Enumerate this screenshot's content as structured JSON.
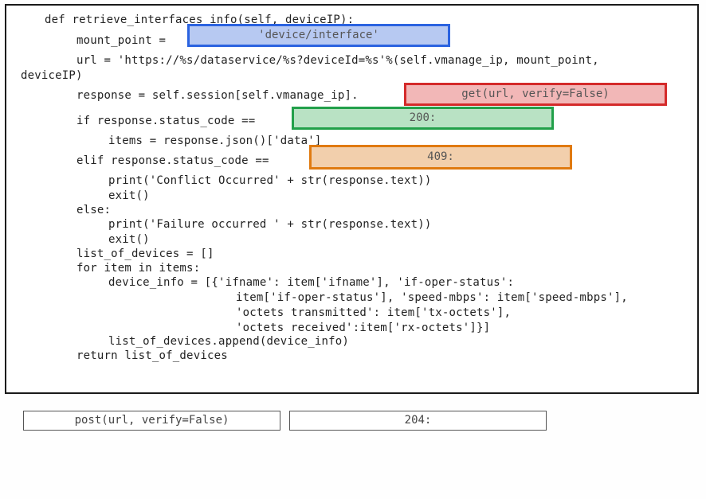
{
  "code": {
    "line1": "def retrieve_interfaces_info(self, deviceIP):",
    "line2": "mount_point = ",
    "line3": "url = 'https://%s/dataservice/%s?deviceId=%s'%(self.vmanage_ip, mount_point,",
    "line4": "deviceIP)",
    "line5": "response = self.session[self.vmanage_ip].",
    "line6": "if response.status_code ==",
    "line7": "items = response.json()['data']",
    "line8": "elif response.status_code ==",
    "line9": "print('Conflict Occurred' + str(response.text))",
    "line10": "exit()",
    "line11": "else:",
    "line12": "print('Failure occurred ' + str(response.text))",
    "line13": "exit()",
    "line14": "list_of_devices = []",
    "line15": "for item in items:",
    "line16": "device_info = [{'ifname': item['ifname'], 'if-oper-status':",
    "line17": "item['if-oper-status'], 'speed-mbps': item['speed-mbps'],",
    "line18": "'octets transmitted': item['tx-octets'],",
    "line19": "'octets received':item['rx-octets']}]",
    "line20": "list_of_devices.append(device_info)",
    "line21": "return list_of_devices"
  },
  "slots": {
    "mount_point": "'device/interface'",
    "method": "get(url, verify=False)",
    "status_ok": "200:",
    "status_conflict": "409:"
  },
  "options": {
    "post": "post(url, verify=False)",
    "status_204": "204:"
  },
  "colors": {
    "blue": "#2b63e0",
    "red": "#d42a2a",
    "green": "#22a04a",
    "orange": "#e07a10"
  }
}
